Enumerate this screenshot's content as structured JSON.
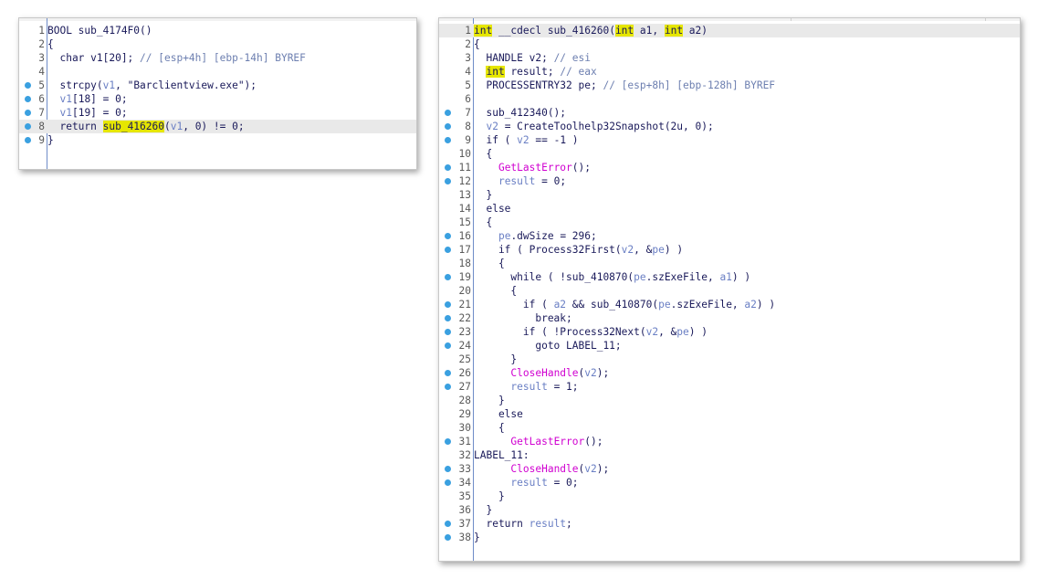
{
  "left_panel": {
    "lines": [
      {
        "n": "1",
        "dot": false,
        "hl": false,
        "tokens": [
          {
            "t": "BOOL sub_4174F0()"
          }
        ]
      },
      {
        "n": "2",
        "dot": false,
        "hl": false,
        "tokens": [
          {
            "t": "{"
          }
        ]
      },
      {
        "n": "3",
        "dot": false,
        "hl": false,
        "tokens": [
          {
            "t": "  char v1[20]; "
          },
          {
            "t": "// [esp+4h] [ebp-14h] BYREF",
            "c": "cmt"
          }
        ]
      },
      {
        "n": "4",
        "dot": false,
        "hl": false,
        "tokens": [
          {
            "t": ""
          }
        ]
      },
      {
        "n": "5",
        "dot": true,
        "hl": false,
        "tokens": [
          {
            "t": "  strcpy("
          },
          {
            "t": "v1",
            "c": "var"
          },
          {
            "t": ", \"Barclientview.exe\");"
          }
        ]
      },
      {
        "n": "6",
        "dot": true,
        "hl": false,
        "tokens": [
          {
            "t": "  "
          },
          {
            "t": "v1",
            "c": "var"
          },
          {
            "t": "[18] = 0;"
          }
        ]
      },
      {
        "n": "7",
        "dot": true,
        "hl": false,
        "tokens": [
          {
            "t": "  "
          },
          {
            "t": "v1",
            "c": "var"
          },
          {
            "t": "[19] = 0;"
          }
        ]
      },
      {
        "n": "8",
        "dot": true,
        "hl": true,
        "tokens": [
          {
            "t": "  return "
          },
          {
            "t": "sub_416260",
            "c": "hlw"
          },
          {
            "t": "("
          },
          {
            "t": "v1",
            "c": "var"
          },
          {
            "t": ", 0) != 0;"
          }
        ]
      },
      {
        "n": "9",
        "dot": true,
        "hl": false,
        "tokens": [
          {
            "t": "}"
          }
        ]
      }
    ]
  },
  "right_panel": {
    "lines": [
      {
        "n": "1",
        "dot": false,
        "hl": true,
        "tokens": [
          {
            "t": "int",
            "c": "kw"
          },
          {
            "t": " __cdecl sub_416260("
          },
          {
            "t": "int",
            "c": "kw"
          },
          {
            "t": " a1, "
          },
          {
            "t": "int",
            "c": "kw"
          },
          {
            "t": " a2)"
          }
        ]
      },
      {
        "n": "2",
        "dot": false,
        "hl": false,
        "tokens": [
          {
            "t": "{"
          }
        ]
      },
      {
        "n": "3",
        "dot": false,
        "hl": false,
        "tokens": [
          {
            "t": "  HANDLE v2; "
          },
          {
            "t": "// esi",
            "c": "cmt"
          }
        ]
      },
      {
        "n": "4",
        "dot": false,
        "hl": false,
        "tokens": [
          {
            "t": "  "
          },
          {
            "t": "int",
            "c": "kw"
          },
          {
            "t": " result; "
          },
          {
            "t": "// eax",
            "c": "cmt"
          }
        ]
      },
      {
        "n": "5",
        "dot": false,
        "hl": false,
        "tokens": [
          {
            "t": "  PROCESSENTRY32 pe; "
          },
          {
            "t": "// [esp+8h] [ebp-128h] BYREF",
            "c": "cmt"
          }
        ]
      },
      {
        "n": "6",
        "dot": false,
        "hl": false,
        "tokens": [
          {
            "t": ""
          }
        ]
      },
      {
        "n": "7",
        "dot": true,
        "hl": false,
        "tokens": [
          {
            "t": "  sub_412340();"
          }
        ]
      },
      {
        "n": "8",
        "dot": true,
        "hl": false,
        "tokens": [
          {
            "t": "  "
          },
          {
            "t": "v2",
            "c": "var"
          },
          {
            "t": " = CreateToolhelp32Snapshot(2u, 0);"
          }
        ]
      },
      {
        "n": "9",
        "dot": true,
        "hl": false,
        "tokens": [
          {
            "t": "  if ( "
          },
          {
            "t": "v2",
            "c": "var"
          },
          {
            "t": " == -1 )"
          }
        ]
      },
      {
        "n": "10",
        "dot": false,
        "hl": false,
        "tokens": [
          {
            "t": "  {"
          }
        ]
      },
      {
        "n": "11",
        "dot": true,
        "hl": false,
        "tokens": [
          {
            "t": "    "
          },
          {
            "t": "GetLastError",
            "c": "fn"
          },
          {
            "t": "();"
          }
        ]
      },
      {
        "n": "12",
        "dot": true,
        "hl": false,
        "tokens": [
          {
            "t": "    "
          },
          {
            "t": "result",
            "c": "var"
          },
          {
            "t": " = 0;"
          }
        ]
      },
      {
        "n": "13",
        "dot": false,
        "hl": false,
        "tokens": [
          {
            "t": "  }"
          }
        ]
      },
      {
        "n": "14",
        "dot": false,
        "hl": false,
        "tokens": [
          {
            "t": "  else"
          }
        ]
      },
      {
        "n": "15",
        "dot": false,
        "hl": false,
        "tokens": [
          {
            "t": "  {"
          }
        ]
      },
      {
        "n": "16",
        "dot": true,
        "hl": false,
        "tokens": [
          {
            "t": "    "
          },
          {
            "t": "pe",
            "c": "var"
          },
          {
            "t": ".dwSize = 296;"
          }
        ]
      },
      {
        "n": "17",
        "dot": true,
        "hl": false,
        "tokens": [
          {
            "t": "    if ( Process32First("
          },
          {
            "t": "v2",
            "c": "var"
          },
          {
            "t": ", &"
          },
          {
            "t": "pe",
            "c": "var"
          },
          {
            "t": ") )"
          }
        ]
      },
      {
        "n": "18",
        "dot": false,
        "hl": false,
        "tokens": [
          {
            "t": "    {"
          }
        ]
      },
      {
        "n": "19",
        "dot": true,
        "hl": false,
        "tokens": [
          {
            "t": "      while ( !sub_410870("
          },
          {
            "t": "pe",
            "c": "var"
          },
          {
            "t": ".szExeFile, "
          },
          {
            "t": "a1",
            "c": "var"
          },
          {
            "t": ") )"
          }
        ]
      },
      {
        "n": "20",
        "dot": false,
        "hl": false,
        "tokens": [
          {
            "t": "      {"
          }
        ]
      },
      {
        "n": "21",
        "dot": true,
        "hl": false,
        "tokens": [
          {
            "t": "        if ( "
          },
          {
            "t": "a2",
            "c": "var"
          },
          {
            "t": " && sub_410870("
          },
          {
            "t": "pe",
            "c": "var"
          },
          {
            "t": ".szExeFile, "
          },
          {
            "t": "a2",
            "c": "var"
          },
          {
            "t": ") )"
          }
        ]
      },
      {
        "n": "22",
        "dot": true,
        "hl": false,
        "tokens": [
          {
            "t": "          break;"
          }
        ]
      },
      {
        "n": "23",
        "dot": true,
        "hl": false,
        "tokens": [
          {
            "t": "        if ( !Process32Next("
          },
          {
            "t": "v2",
            "c": "var"
          },
          {
            "t": ", &"
          },
          {
            "t": "pe",
            "c": "var"
          },
          {
            "t": ") )"
          }
        ]
      },
      {
        "n": "24",
        "dot": true,
        "hl": false,
        "tokens": [
          {
            "t": "          goto LABEL_11;"
          }
        ]
      },
      {
        "n": "25",
        "dot": false,
        "hl": false,
        "tokens": [
          {
            "t": "      }"
          }
        ]
      },
      {
        "n": "26",
        "dot": true,
        "hl": false,
        "tokens": [
          {
            "t": "      "
          },
          {
            "t": "CloseHandle",
            "c": "fn"
          },
          {
            "t": "("
          },
          {
            "t": "v2",
            "c": "var"
          },
          {
            "t": ");"
          }
        ]
      },
      {
        "n": "27",
        "dot": true,
        "hl": false,
        "tokens": [
          {
            "t": "      "
          },
          {
            "t": "result",
            "c": "var"
          },
          {
            "t": " = 1;"
          }
        ]
      },
      {
        "n": "28",
        "dot": false,
        "hl": false,
        "tokens": [
          {
            "t": "    }"
          }
        ]
      },
      {
        "n": "29",
        "dot": false,
        "hl": false,
        "tokens": [
          {
            "t": "    else"
          }
        ]
      },
      {
        "n": "30",
        "dot": false,
        "hl": false,
        "tokens": [
          {
            "t": "    {"
          }
        ]
      },
      {
        "n": "31",
        "dot": true,
        "hl": false,
        "tokens": [
          {
            "t": "      "
          },
          {
            "t": "GetLastError",
            "c": "fn"
          },
          {
            "t": "();"
          }
        ]
      },
      {
        "n": "32",
        "dot": false,
        "hl": false,
        "tokens": [
          {
            "t": "LABEL_11:"
          }
        ]
      },
      {
        "n": "33",
        "dot": true,
        "hl": false,
        "tokens": [
          {
            "t": "      "
          },
          {
            "t": "CloseHandle",
            "c": "fn"
          },
          {
            "t": "("
          },
          {
            "t": "v2",
            "c": "var"
          },
          {
            "t": ");"
          }
        ]
      },
      {
        "n": "34",
        "dot": true,
        "hl": false,
        "tokens": [
          {
            "t": "      "
          },
          {
            "t": "result",
            "c": "var"
          },
          {
            "t": " = 0;"
          }
        ]
      },
      {
        "n": "35",
        "dot": false,
        "hl": false,
        "tokens": [
          {
            "t": "    }"
          }
        ]
      },
      {
        "n": "36",
        "dot": false,
        "hl": false,
        "tokens": [
          {
            "t": "  }"
          }
        ]
      },
      {
        "n": "37",
        "dot": true,
        "hl": false,
        "tokens": [
          {
            "t": "  return "
          },
          {
            "t": "result",
            "c": "var"
          },
          {
            "t": ";"
          }
        ]
      },
      {
        "n": "38",
        "dot": true,
        "hl": false,
        "tokens": [
          {
            "t": "}"
          }
        ]
      }
    ]
  },
  "colors": {
    "breakpoint_dot": "#3aa0e0",
    "keyword_highlight": "#e6e600",
    "function_name": "#d000d0",
    "variable": "#6a7fc4",
    "comment": "#6d7fb0",
    "line_highlight": "#e9e9e9",
    "gutter_line": "#6e8cc8"
  }
}
